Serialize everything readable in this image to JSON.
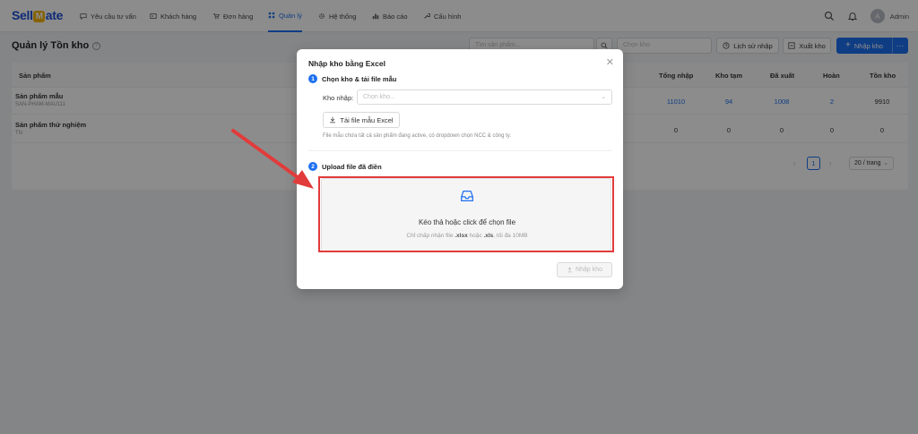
{
  "app": {
    "logo_prefix": "Sell",
    "logo_mark": "M",
    "logo_suffix": "ate"
  },
  "nav": {
    "items": [
      {
        "label": "Yêu cầu tư vấn",
        "icon": "chat-icon"
      },
      {
        "label": "Khách hàng",
        "icon": "contact-card-icon"
      },
      {
        "label": "Đơn hàng",
        "icon": "cart-icon"
      },
      {
        "label": "Quản lý",
        "icon": "grid-icon",
        "active": true
      },
      {
        "label": "Hệ thống",
        "icon": "gear-icon"
      },
      {
        "label": "Báo cáo",
        "icon": "bar-chart-icon"
      },
      {
        "label": "Cấu hình",
        "icon": "wrench-icon"
      }
    ],
    "user": {
      "avatar_letter": "A",
      "name": "Admin"
    }
  },
  "page": {
    "title": "Quản lý Tồn kho",
    "search_placeholder": "Tìm sản phẩm...",
    "warehouse_placeholder": "Chọn kho",
    "history_label": "Lịch sử nhập",
    "export_label": "Xuất kho",
    "import_label": "Nhập kho"
  },
  "table": {
    "columns": {
      "product": "Sản phẩm",
      "total_import": "Tổng nhập",
      "temp_stock": "Kho tạm",
      "exported": "Đã xuất",
      "returned": "Hoàn",
      "in_stock": "Tồn kho"
    },
    "rows": [
      {
        "name": "Sản phẩm mẫu",
        "sku": "SAN-PHAM-MAU111",
        "total_import": "11010",
        "temp_stock": "94",
        "exported": "1008",
        "returned": "2",
        "in_stock": "9910"
      },
      {
        "name": "Sản phẩm thử nghiệm",
        "sku": "TN",
        "total_import": "0",
        "temp_stock": "0",
        "exported": "0",
        "returned": "0",
        "in_stock": "0"
      }
    ],
    "pagination": {
      "current_page": "1",
      "page_size": "20 / trang"
    }
  },
  "modal": {
    "title": "Nhập kho bằng Excel",
    "step1": {
      "number": "1",
      "title": "Chọn kho & tải file mẫu"
    },
    "warehouse_label": "Kho nhập:",
    "warehouse_placeholder": "Chọn kho...",
    "download_label": "Tải file mẫu Excel",
    "hint": "File mẫu chứa tất cả sản phẩm đang active, có dropdown chọn NCC & công ty.",
    "step2": {
      "number": "2",
      "title": "Upload file đã điền"
    },
    "drop_title": "Kéo thả hoặc click để chọn file",
    "drop_sub_prefix": "Chỉ chấp nhận file ",
    "drop_sub_xlsx": ".xlsx",
    "drop_sub_mid": " hoặc ",
    "drop_sub_xls": ".xls",
    "drop_sub_suffix": ", tối đa 10MB",
    "submit_label": "Nhập kho"
  },
  "colors": {
    "primary": "#1d6ff0",
    "highlight": "#e23b3b"
  }
}
